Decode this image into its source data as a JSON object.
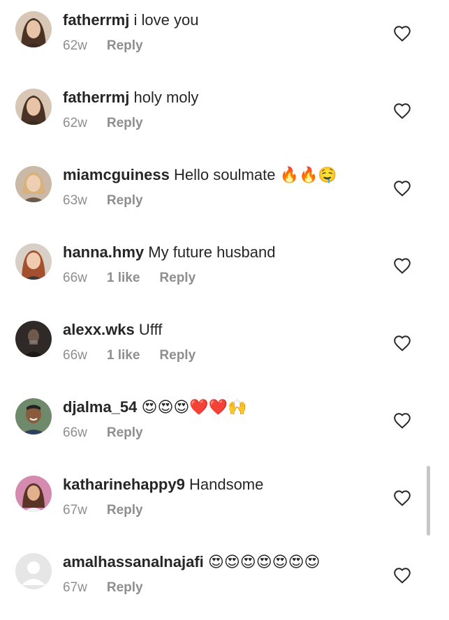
{
  "comments": [
    {
      "username": "fatherrmj",
      "text": "i love you",
      "age": "62w",
      "likes": "",
      "reply": "Reply",
      "avatar": "woman-long-brown-hair"
    },
    {
      "username": "fatherrmj",
      "text": "holy moly",
      "age": "62w",
      "likes": "",
      "reply": "Reply",
      "avatar": "woman-long-brown-hair"
    },
    {
      "username": "miamcguiness",
      "text": "Hello soulmate 🔥🔥🤤",
      "age": "63w",
      "likes": "",
      "reply": "Reply",
      "avatar": "woman-blonde"
    },
    {
      "username": "hanna.hmy",
      "text": "My future husband",
      "age": "66w",
      "likes": "1 like",
      "reply": "Reply",
      "avatar": "woman-red-hair"
    },
    {
      "username": "alexx.wks",
      "text": "Ufff",
      "age": "66w",
      "likes": "1 like",
      "reply": "Reply",
      "avatar": "person-dark-photo"
    },
    {
      "username": "djalma_54",
      "text": "😍😍😍❤️❤️🙌",
      "age": "66w",
      "likes": "",
      "reply": "Reply",
      "avatar": "man-smiling"
    },
    {
      "username": "katharinehappy9",
      "text": "Handsome",
      "age": "67w",
      "likes": "",
      "reply": "Reply",
      "avatar": "woman-pink-background"
    },
    {
      "username": "amalhassanalnajafi",
      "text": "😍😍😍😍😍😍😍",
      "age": "67w",
      "likes": "",
      "reply": "Reply",
      "avatar": "default-avatar"
    }
  ],
  "colors": {
    "text": "#262626",
    "secondary": "#8e8e8e",
    "background": "#ffffff"
  }
}
